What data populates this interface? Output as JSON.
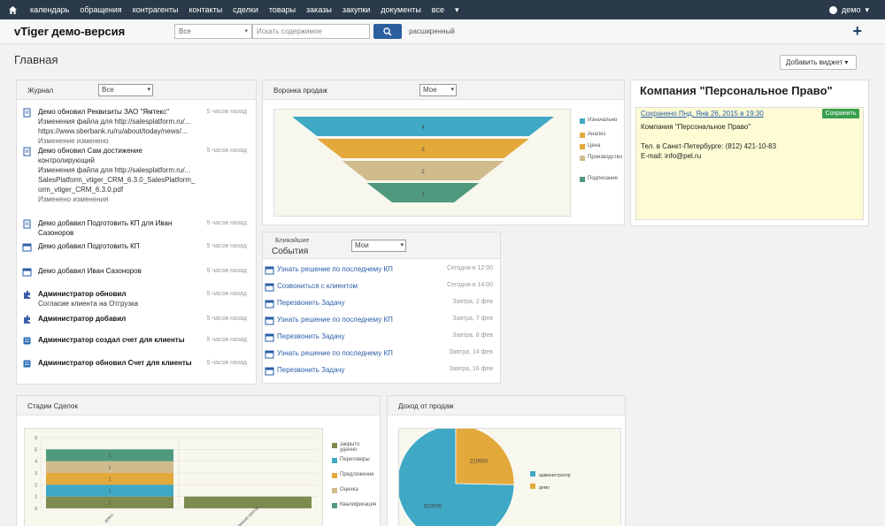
{
  "page_data": {
    "nav": {
      "items": [
        "календарь",
        "обращения",
        "контрагенты",
        "контакты",
        "сделки",
        "товары",
        "заказы",
        "закупки",
        "документы",
        "все"
      ],
      "user": "демо"
    },
    "header": {
      "logo": "vTiger демо-версия",
      "search_select": "Все",
      "search_placeholder": "Искать содержимое",
      "advanced": "расширенный",
      "plus": "+"
    },
    "page": {
      "title": "Главная",
      "add_widget": "Добавить виджет"
    },
    "journal": {
      "title": "Журнал",
      "filter": "Все",
      "items": [
        {
          "icon": "document-icon",
          "main": "Демо обновил Реквизиты ЗАО \"Ямтекс\"",
          "extra": [
            "Изменения файла для http://salesplatform.ru/...",
            "https://www.sberbank.ru/ru/about/today/news/..."
          ],
          "tag": "Изменение изменено",
          "time": "5 часов назад"
        },
        {
          "icon": "document-icon",
          "main": "Демо обновил Сам достижение",
          "extra": [
            "контролирующий",
            "Изменения файла для http://salesplatform.ru/...",
            "SalesPlatform_vtiger_CRM_6.3.0_SalesPlatform_",
            "orm_vtiger_CRM_6.3.0.pdf"
          ],
          "tag": "Изменено изменения",
          "time": "5 часов назад"
        },
        {
          "icon": "document-icon",
          "main": "Демо добавил Подготовить КП для Иван Сазоноров",
          "extra": [],
          "tag": "",
          "time": "5 часов назад"
        },
        {
          "icon": "calendar-icon",
          "main": "Демо добавил Подготовить КП",
          "extra": [],
          "tag": "",
          "time": "5 часов назад"
        },
        {
          "icon": "calendar-icon",
          "main": "Демо добавил Иван Сазоноров",
          "extra": [],
          "tag": "",
          "time": "5 часов назад"
        },
        {
          "icon": "puzzle-icon",
          "main": "Администратор обновил",
          "extra": [
            "Согласие клиента на Отгрузка"
          ],
          "tag": "",
          "time": "5 часов назад"
        },
        {
          "icon": "puzzle-icon",
          "main": "Администратор добавил",
          "extra": [],
          "tag": "",
          "time": "5 часов назад"
        },
        {
          "icon": "invoice-icon",
          "main": "Администратор создал счет для клиенты",
          "extra": [],
          "tag": "",
          "time": "5 часов назад"
        },
        {
          "icon": "invoice-icon",
          "main": "Администратор обновил Счет для клиенты",
          "extra": [],
          "tag": "",
          "time": "5 часов назад"
        }
      ]
    },
    "funnel": {
      "title": "Воронка продаж",
      "filter": "Мое"
    },
    "events": {
      "title_line1": "Ближайшие",
      "title_line2": "События",
      "filter": "Мои",
      "rows": [
        {
          "subject": "Узнать решение по последнему КП",
          "date": "Сегодня в 12:00"
        },
        {
          "subject": "Созвониться с клиентом",
          "date": "Сегодня в 14:00"
        },
        {
          "subject": "Перезвонить Задачу",
          "date": "Завтра, 2 фев"
        },
        {
          "subject": "Узнать решение по последнему КП",
          "date": "Завтра, 7 фев"
        },
        {
          "subject": "Перезвонить Задачу",
          "date": "Завтра, 8 фев"
        },
        {
          "subject": "Узнать решение по последнему КП",
          "date": "Завтра, 14 фев"
        },
        {
          "subject": "Перезвонить Задачу",
          "date": "Завтра, 16 фев"
        }
      ]
    },
    "company": {
      "title": "Компания \"Персональное Право\"",
      "meta": "Сохранено Пнд, Янв 26, 2015 в 19:30",
      "save": "Сохранить",
      "note": "Компания \"Персональное Право\"\n\nТел. в Санкт-Петербурге: (812) 421-10-83\nE-mail: info@pel.ru"
    },
    "stages": {
      "title": "Стадии Сделок"
    },
    "revenue": {
      "title": "Доход от продаж"
    },
    "colors": {
      "nav_bg": "#2b3a4a",
      "search_btn": "#2b5f9f",
      "link": "#2a5ea8",
      "save_btn": "#3aa050",
      "note_bg": "#fdfcd4",
      "teal": "#3fa8c4",
      "orange": "#e3a93a",
      "tan": "#d0bb8c",
      "green": "#4f9a7e",
      "olive": "#7d8b50"
    },
    "chart_data": [
      {
        "type": "funnel",
        "categories": [
          "Изначально",
          "Анализ",
          "Цена",
          "Производство",
          "Подписание"
        ],
        "values": [
          4,
          3,
          2,
          1,
          1
        ],
        "legend_position": "right"
      },
      {
        "type": "bar",
        "stacked": true,
        "categories": [
          "демо",
          "администратор"
        ],
        "ylim": [
          0,
          6
        ],
        "yticks": [
          0,
          1,
          2,
          3,
          4,
          5,
          6
        ],
        "series": [
          {
            "name": "закрыто удачно",
            "values": [
              1,
              1
            ]
          },
          {
            "name": "Переговоры",
            "values": [
              1,
              0
            ]
          },
          {
            "name": "Предложение",
            "values": [
              1,
              0
            ]
          },
          {
            "name": "Оценка",
            "values": [
              1,
              0
            ]
          },
          {
            "name": "Квалификация",
            "values": [
              1,
              0
            ]
          }
        ],
        "segment_labels": [
          "1",
          "1",
          "1",
          "1",
          "1"
        ],
        "legend": [
          "закрыто удачно",
          "Переговоры",
          "Предложение",
          "Оценка",
          "Квалификация"
        ],
        "legend_position": "right"
      },
      {
        "type": "pie",
        "labels": [
          "администратор",
          "демо"
        ],
        "values": [
          620000,
          210000
        ],
        "data_labels": [
          "620000",
          "210000"
        ],
        "legend_position": "right"
      }
    ]
  }
}
